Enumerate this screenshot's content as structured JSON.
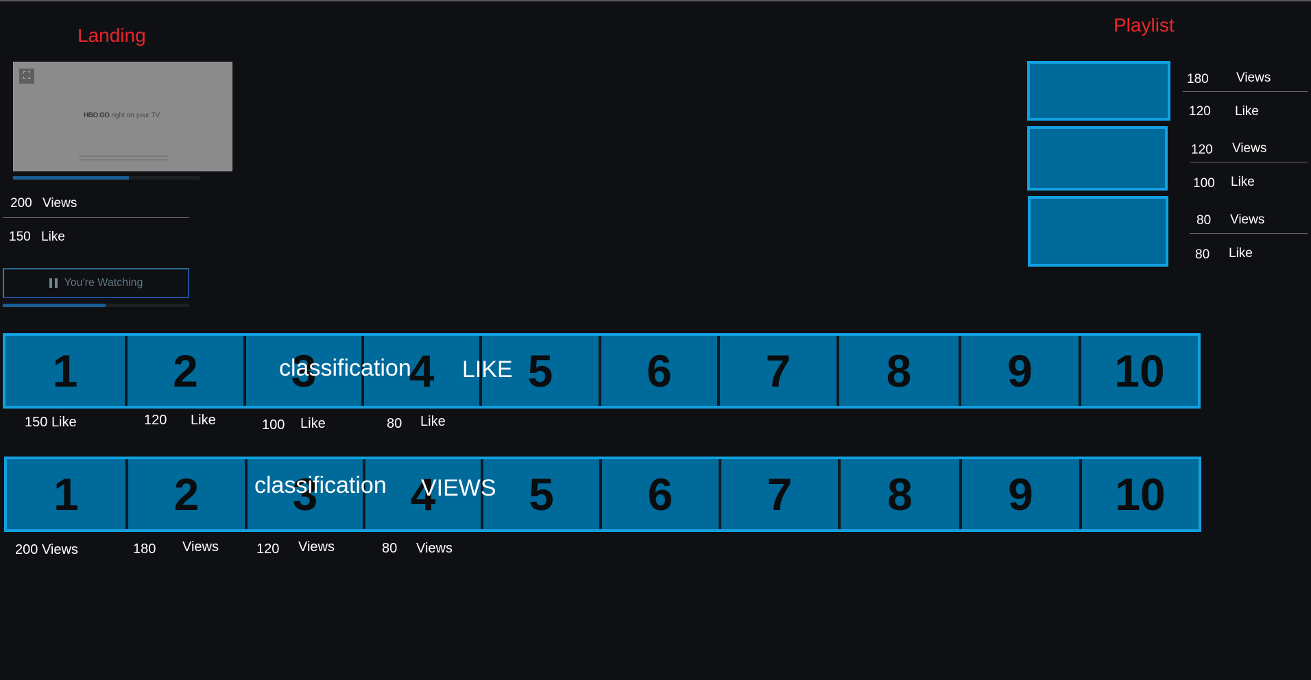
{
  "landing": {
    "title": "Landing",
    "video": {
      "logo_text": "HBO GO",
      "caption": "right on your TV.",
      "progress_fraction": 0.62
    },
    "views_count": "200",
    "views_label": "Views",
    "likes_count": "150",
    "likes_label": "Like",
    "watching_button_label": "You're Watching",
    "watching_progress_fraction": 0.55
  },
  "playlist": {
    "title": "Playlist",
    "items": [
      {
        "views_count": "180",
        "views_label": "Views",
        "likes_count": "120",
        "likes_label": "Like"
      },
      {
        "views_count": "120",
        "views_label": "Views",
        "likes_count": "100",
        "likes_label": "Like"
      },
      {
        "views_count": "80",
        "views_label": "Views",
        "likes_count": "80",
        "likes_label": "Like"
      }
    ]
  },
  "like_classification": {
    "overlay_text": "classification",
    "category_label": "LIKE",
    "cells": [
      "1",
      "2",
      "3",
      "4",
      "5",
      "6",
      "7",
      "8",
      "9",
      "10"
    ],
    "stats": [
      {
        "count": "150",
        "label": "Like"
      },
      {
        "count": "120",
        "label": "Like"
      },
      {
        "count": "100",
        "label": "Like"
      },
      {
        "count": "80",
        "label": "Like"
      }
    ]
  },
  "views_classification": {
    "overlay_text": "classification",
    "category_label": "VIEWS",
    "cells": [
      "1",
      "2",
      "3",
      "4",
      "5",
      "6",
      "7",
      "8",
      "9",
      "10"
    ],
    "stats": [
      {
        "count": "200",
        "label": "Views"
      },
      {
        "count": "180",
        "label": "Views"
      },
      {
        "count": "120",
        "label": "Views"
      },
      {
        "count": "80",
        "label": "Views"
      }
    ]
  },
  "colors": {
    "background": "#0f1013",
    "title_red": "#e8262b",
    "tile_fill": "#006a9a",
    "tile_border": "#12a0e0",
    "progress": "#1a5c94"
  }
}
